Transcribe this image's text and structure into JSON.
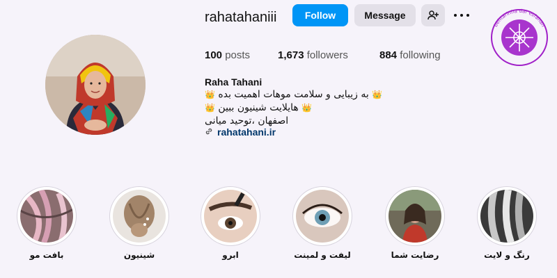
{
  "profile": {
    "username": "rahatahaniii",
    "full_name": "Raha Tahani",
    "posts_count": "100",
    "posts_label": "posts",
    "followers_count": "1,673",
    "followers_label": "followers",
    "following_count": "884",
    "following_label": "following",
    "bio_line1": "به زیبایی و سلامت موهات اهمیت بده",
    "bio_line2": "هایلایت شینیون ببین",
    "bio_line3": "اصفهان ،توحید میانی",
    "crown_glyph": "👑",
    "link_text": "rahatahani.ir"
  },
  "actions": {
    "follow_label": "Follow",
    "message_label": "Message",
    "suggest_icon": "person-add-icon",
    "more_icon": "more-options-icon"
  },
  "colors": {
    "follow_bg": "#0095f6",
    "link": "#00376b",
    "logo": "#a020c8"
  },
  "logo": {
    "text": "بهترینها در اصفهان behtarinha dar esfahan"
  },
  "highlights": [
    {
      "label": "بافت مو"
    },
    {
      "label": "شینیون"
    },
    {
      "label": "ابرو"
    },
    {
      "label": "لیفت و لمینت"
    },
    {
      "label": "رضایت شما"
    },
    {
      "label": "رنگ و لایت"
    }
  ]
}
